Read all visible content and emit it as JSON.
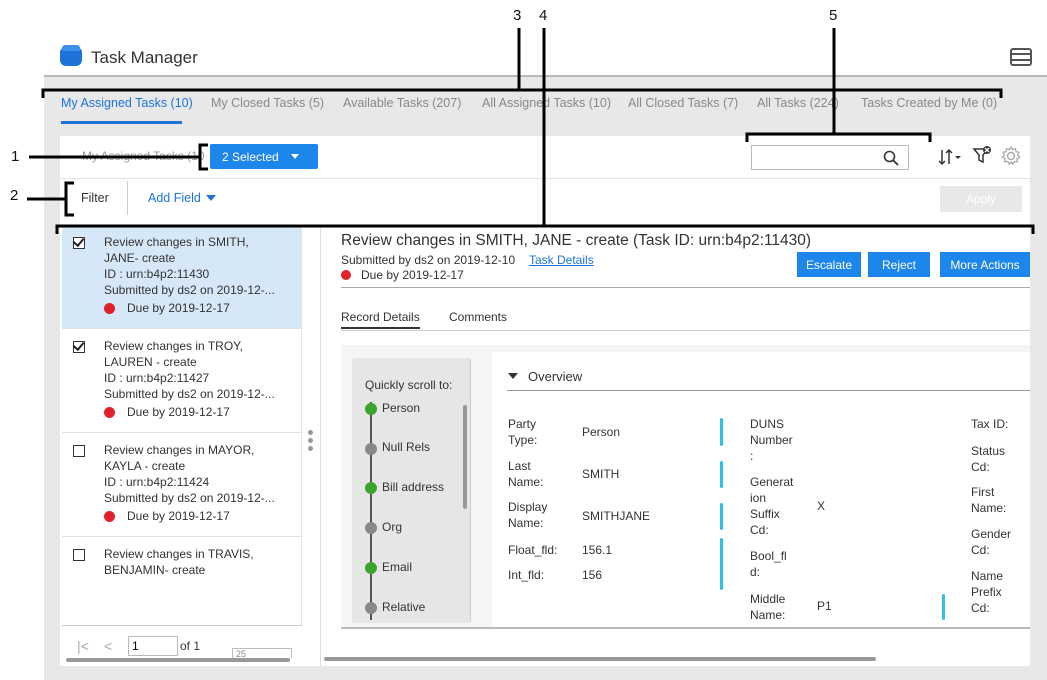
{
  "app": {
    "title": "Task Manager"
  },
  "tabs": [
    {
      "label": "My Assigned Tasks (10)",
      "active": true
    },
    {
      "label": "My Closed Tasks (5)"
    },
    {
      "label": "Available Tasks (207)"
    },
    {
      "label": "All Assigned Tasks (10)"
    },
    {
      "label": "All Closed Tasks (7)"
    },
    {
      "label": "All Tasks (224)"
    },
    {
      "label": "Tasks Created by Me (0)"
    }
  ],
  "toolbar": {
    "title": "My Assigned Tasks (10",
    "selected_label": "2 Selected",
    "search_value": ""
  },
  "filter": {
    "label": "Filter",
    "add_field": "Add Field",
    "apply": "Apply"
  },
  "tasks": [
    {
      "text": "Review changes in SMITH, JANE- create\nID : urn:b4p2:11430\nSubmitted by ds2 on 2019-12-...",
      "line1": "Review changes in SMITH,",
      "line2": "JANE- create",
      "line3": "ID : urn:b4p2:11430",
      "line4": "Submitted by ds2 on 2019-12-...",
      "due": "Due by 2019-12-17",
      "checked": true,
      "selected": true
    },
    {
      "line1": "Review changes in TROY,",
      "line2": "LAUREN - create",
      "line3": "ID : urn:b4p2:11427",
      "line4": "Submitted by ds2 on 2019-12-...",
      "due": "Due by 2019-12-17",
      "checked": true
    },
    {
      "line1": "Review changes in MAYOR,",
      "line2": "KAYLA - create",
      "line3": "ID : urn:b4p2:11424",
      "line4": "Submitted by ds2 on 2019-12-...",
      "due": "Due by 2019-12-17",
      "checked": false
    },
    {
      "line1": "Review changes in TRAVIS,",
      "line2": "BENJAMIN- create",
      "checked": false
    }
  ],
  "pager": {
    "page": "1",
    "of_label": "of 1",
    "page_size": "25"
  },
  "detail": {
    "title": "Review changes in SMITH, JANE - create (Task ID: urn:b4p2:11430)",
    "submitted": "Submitted by ds2 on 2019-12-10",
    "task_details_link": "Task Details",
    "due": "Due by 2019-12-17",
    "buttons": {
      "escalate": "Escalate",
      "reject": "Reject",
      "more_actions": "More Actions"
    },
    "tabs": {
      "record_details": "Record Details",
      "comments": "Comments"
    },
    "scroll_label": "Quickly scroll to:",
    "timeline": [
      {
        "label": "Person",
        "status": "green"
      },
      {
        "label": "Null Rels",
        "status": "gray"
      },
      {
        "label": "Bill address",
        "status": "green"
      },
      {
        "label": "Org",
        "status": "gray"
      },
      {
        "label": "Email",
        "status": "green"
      },
      {
        "label": "Relative",
        "status": "gray"
      }
    ],
    "overview": {
      "title": "Overview",
      "fields": {
        "party_type": {
          "label_1": "Party",
          "label_2": "Type:",
          "value": "Person"
        },
        "last_name": {
          "label_1": "Last",
          "label_2": "Name:",
          "value": "SMITH"
        },
        "display_name": {
          "label_1": "Display",
          "label_2": "Name:",
          "value": "SMITHJANE"
        },
        "float_fld": {
          "label": "Float_fld:",
          "value": "156.1"
        },
        "int_fld": {
          "label": "Int_fld:",
          "value": "156"
        },
        "duns_number": {
          "label_1": "DUNS",
          "label_2": "Number",
          "label_3": ":"
        },
        "generation_suffix": {
          "label_1": "Generat",
          "label_2": "ion",
          "label_3": "Suffix",
          "label_4": "Cd:",
          "value": "X"
        },
        "bool_fld": {
          "label_1": "Bool_fl",
          "label_2": "d:"
        },
        "middle_name": {
          "label_1": "Middle",
          "label_2": "Name:",
          "value": "P1"
        },
        "tax_id": {
          "label": "Tax ID:"
        },
        "status_cd": {
          "label_1": "Status",
          "label_2": "Cd:"
        },
        "first_name": {
          "label_1": "First",
          "label_2": "Name:"
        },
        "gender_cd": {
          "label_1": "Gender",
          "label_2": "Cd:"
        },
        "name_prefix_cd": {
          "label_1": "Name",
          "label_2": "Prefix",
          "label_3": "Cd:"
        }
      }
    }
  },
  "annotations": [
    "1",
    "2",
    "3",
    "4",
    "5"
  ],
  "colors": {
    "accent": "#1d86ea",
    "due_dot": "#e0202a",
    "done_dot": "#3aa52e",
    "pending_dot": "#888888",
    "field_bar": "#2ec1e8"
  }
}
